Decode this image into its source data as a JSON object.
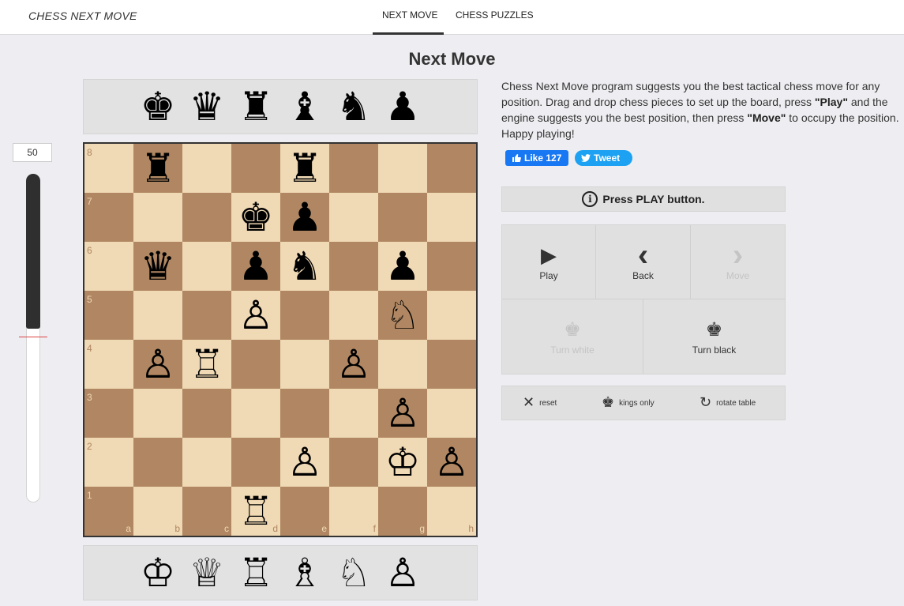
{
  "nav": {
    "brand": "CHESS NEXT MOVE",
    "tabs": [
      {
        "label": "NEXT MOVE",
        "active": true
      },
      {
        "label": "CHESS PUZZLES",
        "active": false
      }
    ]
  },
  "page_title": "Next Move",
  "tray_top": [
    {
      "piece": "king",
      "glyph": "♚"
    },
    {
      "piece": "queen",
      "glyph": "♛"
    },
    {
      "piece": "rook",
      "glyph": "♜"
    },
    {
      "piece": "bishop",
      "glyph": "♝"
    },
    {
      "piece": "knight",
      "glyph": "♞"
    },
    {
      "piece": "pawn",
      "glyph": "♟"
    }
  ],
  "tray_bottom": [
    {
      "piece": "king",
      "glyph": "♔"
    },
    {
      "piece": "queen",
      "glyph": "♕"
    },
    {
      "piece": "rook",
      "glyph": "♖"
    },
    {
      "piece": "bishop",
      "glyph": "♗"
    },
    {
      "piece": "knight",
      "glyph": "♘"
    },
    {
      "piece": "pawn",
      "glyph": "♙"
    }
  ],
  "depth": {
    "value": "50",
    "level_fraction": 0.47
  },
  "board": {
    "files": [
      "a",
      "b",
      "c",
      "d",
      "e",
      "f",
      "g",
      "h"
    ],
    "ranks": [
      "8",
      "7",
      "6",
      "5",
      "4",
      "3",
      "2",
      "1"
    ],
    "position": [
      [
        "",
        "♜",
        "",
        "",
        "♜",
        "",
        "",
        ""
      ],
      [
        "",
        "",
        "",
        "♚",
        "♟",
        "",
        "",
        ""
      ],
      [
        "",
        "♛",
        "",
        "♟",
        "♞",
        "",
        "♟",
        ""
      ],
      [
        "",
        "",
        "",
        "♙",
        "",
        "",
        "♘",
        ""
      ],
      [
        "",
        "♙",
        "♖",
        "",
        "",
        "♙",
        "",
        ""
      ],
      [
        "",
        "",
        "",
        "",
        "",
        "",
        "♙",
        ""
      ],
      [
        "",
        "",
        "",
        "",
        "♙",
        "",
        "♔",
        "♙"
      ],
      [
        "",
        "",
        "",
        "♖",
        "",
        "",
        "",
        ""
      ]
    ]
  },
  "description": {
    "p1": "Chess Next Move program suggests you the best tactical chess move for any position. Drag and drop chess pieces to set up the board, press ",
    "play": "\"Play\"",
    "p2": " and the engine suggests you the best position, then press ",
    "move": "\"Move\"",
    "p3": " to occupy the position. Happy playing!"
  },
  "social": {
    "like_label": "Like 127",
    "tweet_label": "Tweet",
    "like_icon": "thumbs-up-icon",
    "tweet_icon": "twitter-bird-icon"
  },
  "status": {
    "icon": "i",
    "text": "Press PLAY button."
  },
  "controls": {
    "play": "Play",
    "back": "Back",
    "move": "Move",
    "turn_white": "Turn white",
    "turn_black": "Turn black",
    "play_icon": "▶",
    "back_icon": "‹",
    "move_icon": "›",
    "crown_icon": "♚"
  },
  "options": {
    "reset": "reset",
    "kings_only": "kings only",
    "rotate_table": "rotate table",
    "reset_icon": "✕",
    "kings_icon": "♚",
    "rotate_icon": "↻"
  },
  "colors": {
    "light_square": "#f0d9b5",
    "dark_square": "#b08762",
    "facebook": "#1877f2",
    "twitter": "#1da1f2"
  }
}
